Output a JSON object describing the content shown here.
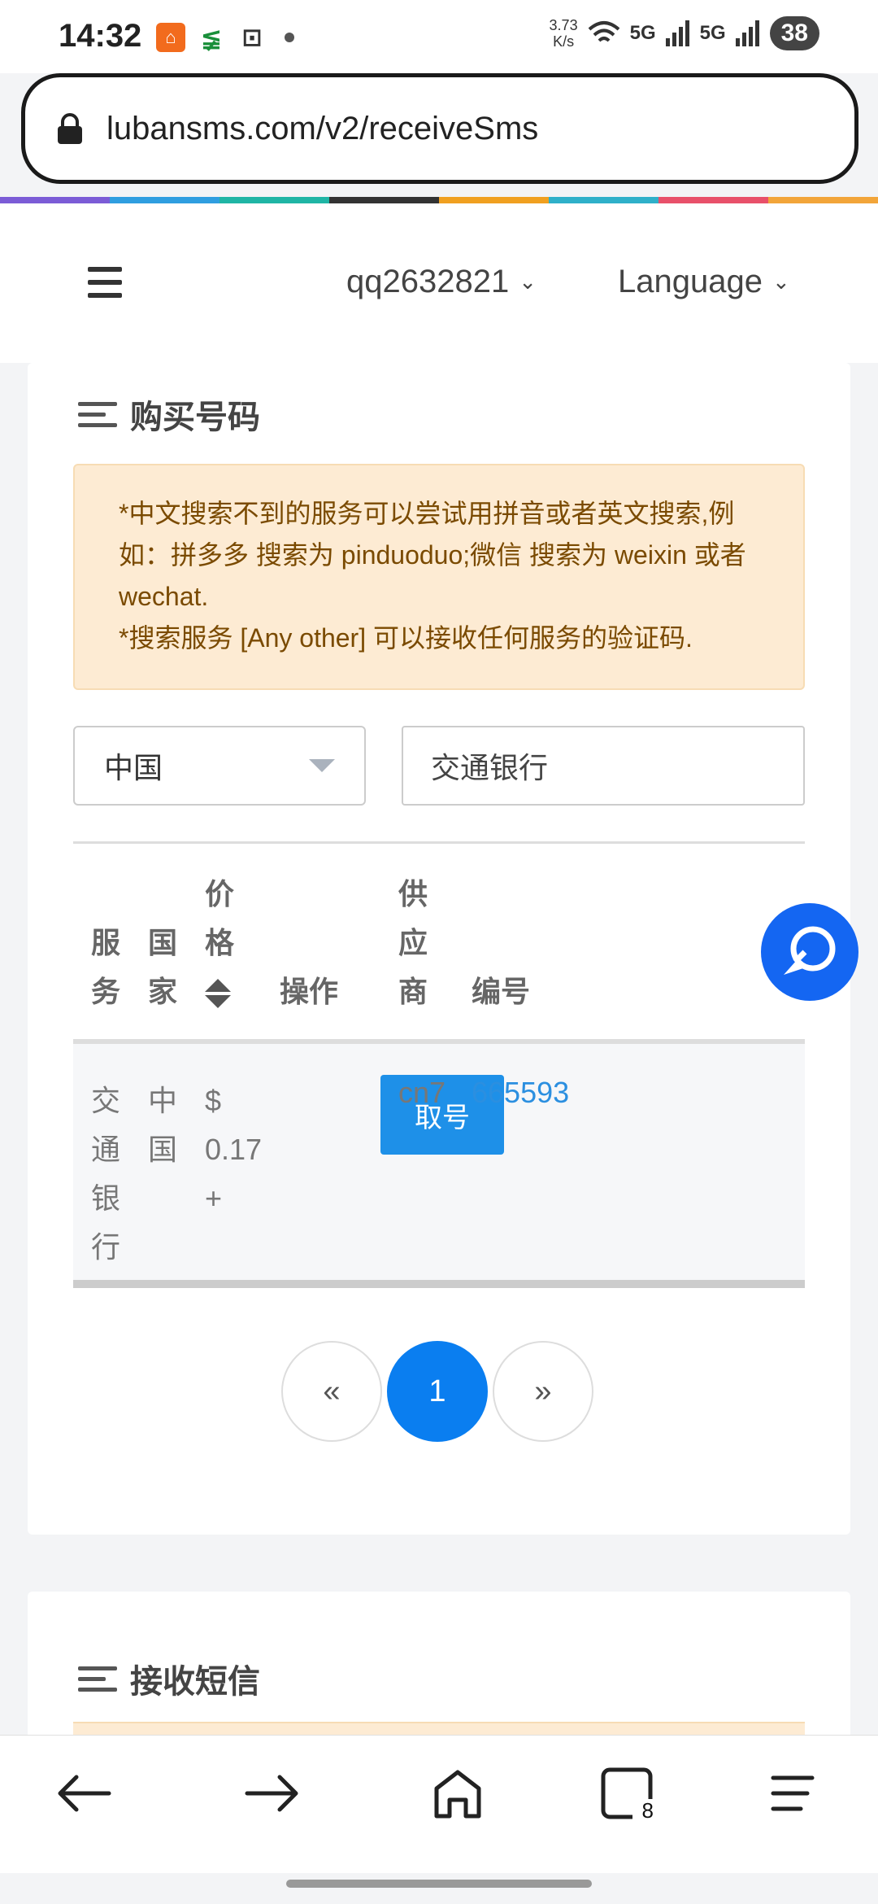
{
  "status_bar": {
    "time": "14:32",
    "net_speed_value": "3.73",
    "net_speed_unit": "K/s",
    "signal_1": "5G",
    "signal_2": "5G",
    "battery": "38"
  },
  "browser": {
    "url": "lubansms.com/v2/receiveSms"
  },
  "header": {
    "user": "qq2632821",
    "language": "Language"
  },
  "buy_section": {
    "title": "购买号码",
    "notice_line1": "*中文搜索不到的服务可以尝试用拼音或者英文搜索,例如：拼多多 搜索为 pinduoduo;微信 搜索为 weixin 或者 wechat.",
    "notice_line2": "*搜索服务 [Any other] 可以接收任何服务的验证码.",
    "country": "中国",
    "search_value": "交通银行"
  },
  "table": {
    "headers": {
      "service": "服务",
      "country": "国家",
      "price": "价格",
      "action": "操作",
      "provider": "供应商",
      "id": "编号"
    },
    "row": {
      "service": "交通银行",
      "country": "中国",
      "price": "$ 0.17 +",
      "action": "取号",
      "provider": "cn7",
      "id": "665593"
    }
  },
  "pagination": {
    "prev": "«",
    "current": "1",
    "next": "»"
  },
  "receive_section": {
    "title": "接收短信"
  },
  "bottom_nav": {
    "tab_count": "8"
  },
  "colors": {
    "primary": "#1e90e8",
    "page_active": "#0a7ef0",
    "float_button": "#1466f2",
    "alert_bg": "#fdebd3"
  }
}
